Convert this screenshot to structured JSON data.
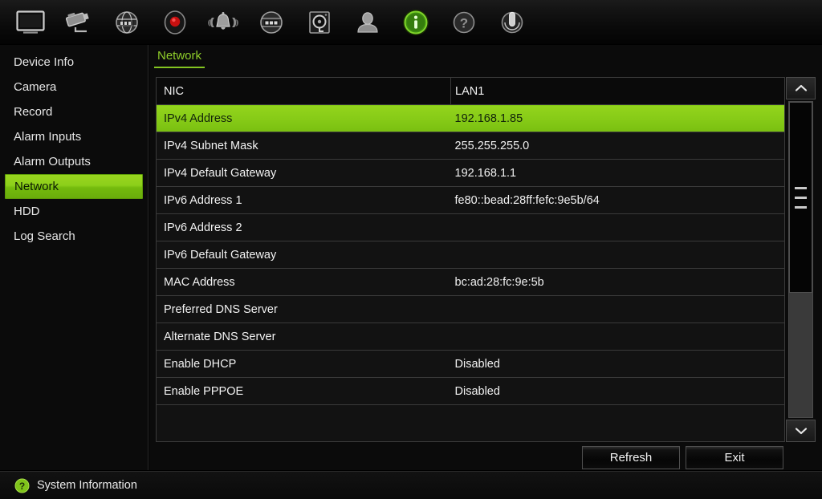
{
  "toolbar": {
    "items": [
      {
        "name": "monitor-icon",
        "label": "Live View"
      },
      {
        "name": "camera-icon",
        "label": "Camera"
      },
      {
        "name": "playback-globe-icon",
        "label": "Playback"
      },
      {
        "name": "record-icon",
        "label": "Record"
      },
      {
        "name": "alarm-bell-icon",
        "label": "Alarm"
      },
      {
        "name": "settings-panel-icon",
        "label": "Settings"
      },
      {
        "name": "hdd-icon",
        "label": "HDD"
      },
      {
        "name": "user-icon",
        "label": "User"
      },
      {
        "name": "info-icon",
        "label": "System Information"
      },
      {
        "name": "help-icon",
        "label": "Help"
      },
      {
        "name": "power-icon",
        "label": "Shutdown"
      }
    ],
    "selected": "info-icon"
  },
  "sidebar": {
    "items": [
      {
        "label": "Device Info"
      },
      {
        "label": "Camera"
      },
      {
        "label": "Record"
      },
      {
        "label": "Alarm Inputs"
      },
      {
        "label": "Alarm Outputs"
      },
      {
        "label": "Network"
      },
      {
        "label": "HDD"
      },
      {
        "label": "Log Search"
      }
    ],
    "selected_index": 5
  },
  "tab": {
    "label": "Network"
  },
  "table": {
    "header": {
      "label": "NIC",
      "value": "LAN1"
    },
    "rows": [
      {
        "label": "IPv4 Address",
        "value": "192.168.1.85",
        "selected": true
      },
      {
        "label": "IPv4 Subnet Mask",
        "value": "255.255.255.0",
        "selected": false
      },
      {
        "label": "IPv4 Default Gateway",
        "value": "192.168.1.1",
        "selected": false
      },
      {
        "label": "IPv6 Address 1",
        "value": "fe80::bead:28ff:fefc:9e5b/64",
        "selected": false
      },
      {
        "label": "IPv6 Address 2",
        "value": "",
        "selected": false
      },
      {
        "label": "IPv6 Default Gateway",
        "value": "",
        "selected": false
      },
      {
        "label": "MAC Address",
        "value": "bc:ad:28:fc:9e:5b",
        "selected": false
      },
      {
        "label": "Preferred DNS Server",
        "value": "",
        "selected": false
      },
      {
        "label": "Alternate DNS Server",
        "value": "",
        "selected": false
      },
      {
        "label": "Enable DHCP",
        "value": "Disabled",
        "selected": false
      },
      {
        "label": "Enable PPPOE",
        "value": "Disabled",
        "selected": false
      }
    ]
  },
  "scrollbar": {
    "up_icon": "chevron-up-icon",
    "down_icon": "chevron-down-icon"
  },
  "buttons": {
    "refresh": "Refresh",
    "exit": "Exit"
  },
  "statusbar": {
    "icon": "help-circle-icon",
    "text": "System Information"
  },
  "colors": {
    "accent_green": "#8ccf1a",
    "accent_green_dark": "#74bb0d",
    "tab_green": "#8fce2a",
    "panel_bg": "#121212",
    "border": "#3a3a3a"
  }
}
